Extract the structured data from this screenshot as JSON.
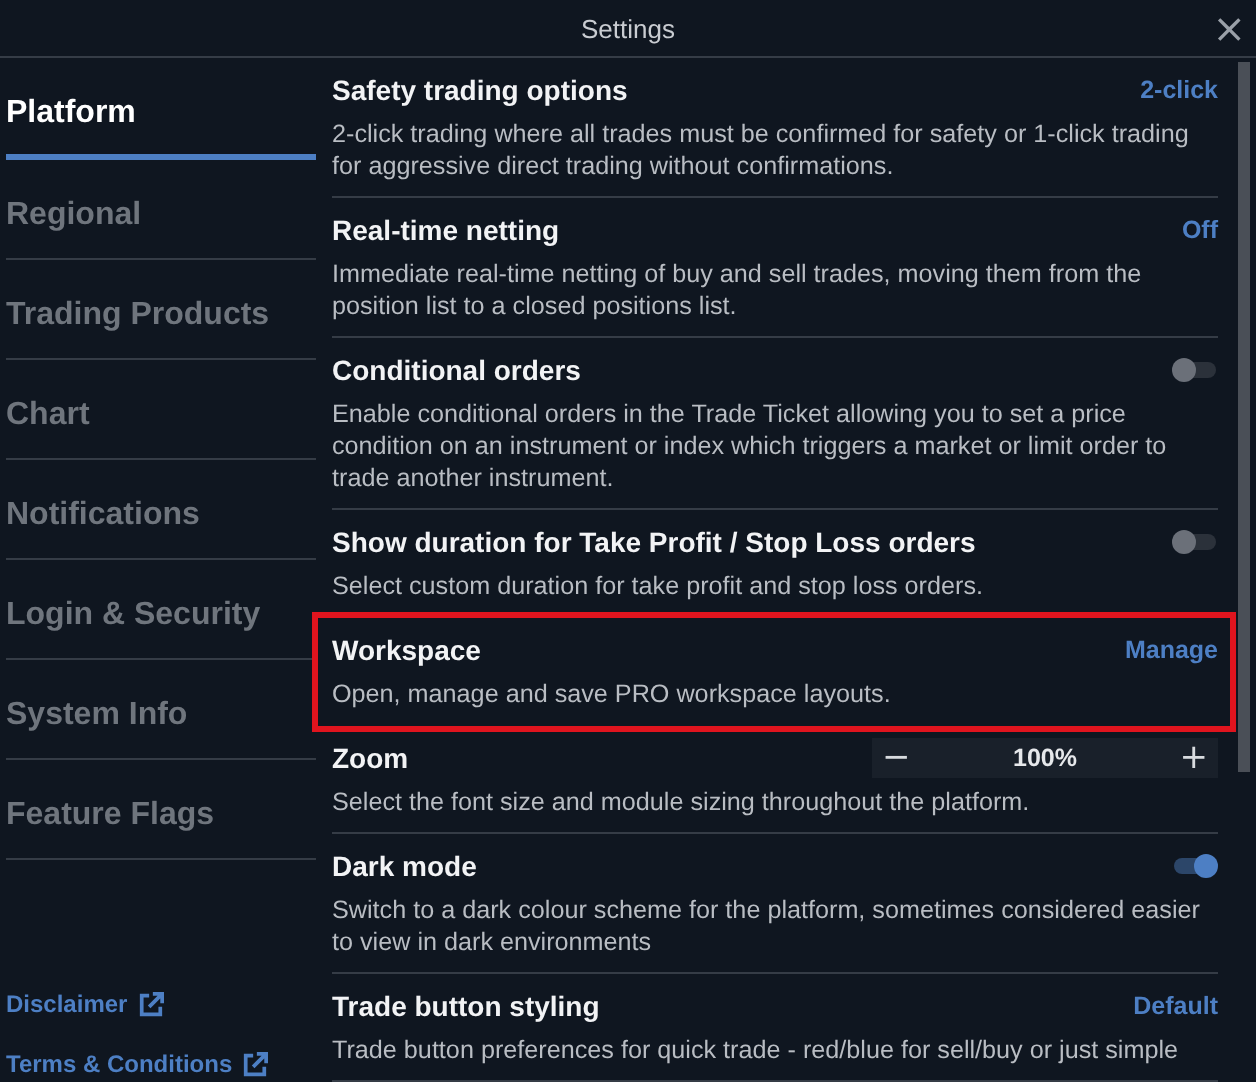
{
  "window": {
    "title": "Settings",
    "close": "×"
  },
  "sidebar": {
    "items": [
      {
        "label": "Platform",
        "selected": true
      },
      {
        "label": "Regional",
        "selected": false
      },
      {
        "label": "Trading Products",
        "selected": false
      },
      {
        "label": "Chart",
        "selected": false
      },
      {
        "label": "Notifications",
        "selected": false
      },
      {
        "label": "Login & Security",
        "selected": false
      },
      {
        "label": "System Info",
        "selected": false
      },
      {
        "label": "Feature Flags",
        "selected": false
      }
    ],
    "links": [
      "Disclaimer",
      "Terms & Conditions"
    ]
  },
  "settings": [
    {
      "kind": "link",
      "title": "Safety trading options",
      "description": "2-click trading where all trades must be confirmed for safety or 1-click trading for aggressive direct trading without confirmations.",
      "value": "2-click",
      "highlighted": false
    },
    {
      "kind": "link",
      "title": "Real-time netting",
      "description": "Immediate real-time netting of buy and sell trades, moving them from the position list to a closed positions list.",
      "value": "Off",
      "highlighted": false
    },
    {
      "kind": "toggle",
      "title": "Conditional orders",
      "description": "Enable conditional orders in the Trade Ticket allowing you to set a price condition on an instrument or index which triggers a market or limit order to trade another instrument.",
      "on": false,
      "highlighted": false
    },
    {
      "kind": "toggle",
      "title": "Show duration for Take Profit / Stop Loss orders",
      "description": "Select custom duration for take profit and stop loss orders.",
      "on": false,
      "highlighted": false
    },
    {
      "kind": "link",
      "title": "Workspace",
      "description": "Open, manage and save PRO workspace layouts.",
      "value": "Manage",
      "highlighted": true
    },
    {
      "kind": "stepper",
      "title": "Zoom",
      "description": "Select the font size and module sizing throughout the platform.",
      "value": "100%",
      "minus": "−",
      "plus": "+",
      "highlighted": false
    },
    {
      "kind": "toggle",
      "title": "Dark mode",
      "description": "Switch to a dark colour scheme for the platform, sometimes considered easier to view in dark environments",
      "on": true,
      "highlighted": false
    },
    {
      "kind": "link",
      "title": "Trade button styling",
      "description": "Trade button preferences for quick trade - red/blue for sell/buy or just simple",
      "value": "Default",
      "highlighted": false
    }
  ]
}
